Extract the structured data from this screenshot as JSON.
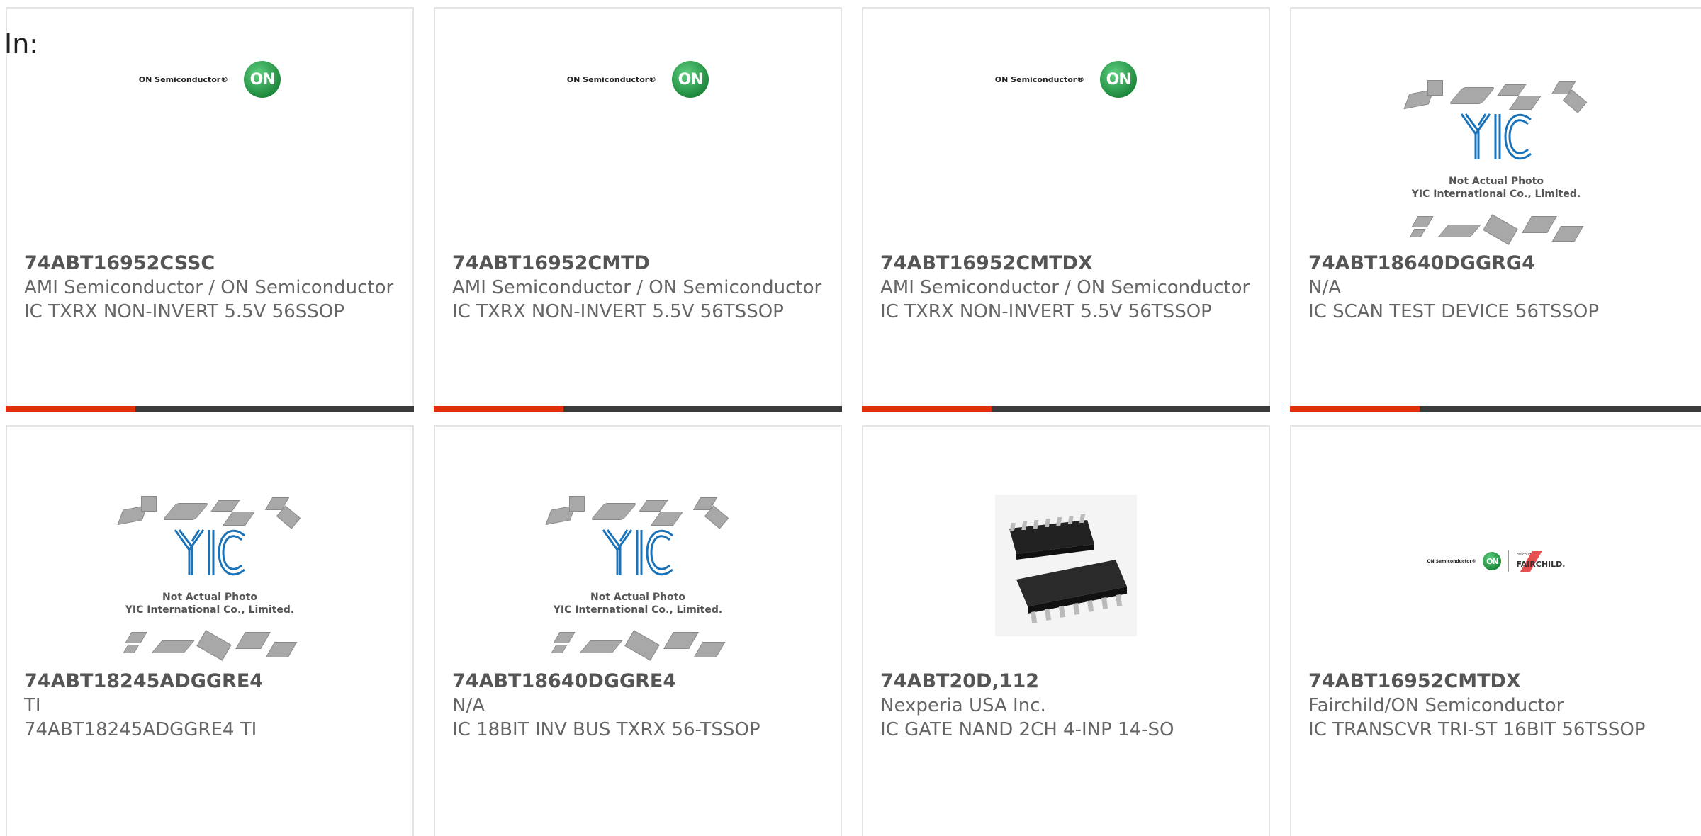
{
  "header": {
    "in_label": "In:"
  },
  "colors": {
    "accent": "#e0310c",
    "bar": "#3b3b3b",
    "on_green": "#1f8a3d",
    "yic_blue": "#1a72b8"
  },
  "products": [
    {
      "part": "74ABT16952CSSC",
      "manufacturer": "AMI Semiconductor / ON Semiconductor",
      "description": "IC TXRX NON-INVERT 5.5V 56SSOP",
      "image": "on-semiconductor-logo"
    },
    {
      "part": "74ABT16952CMTD",
      "manufacturer": "AMI Semiconductor / ON Semiconductor",
      "description": "IC TXRX NON-INVERT 5.5V 56TSSOP",
      "image": "on-semiconductor-logo"
    },
    {
      "part": "74ABT16952CMTDX",
      "manufacturer": "AMI Semiconductor / ON Semiconductor",
      "description": "IC TXRX NON-INVERT 5.5V 56TSSOP",
      "image": "on-semiconductor-logo"
    },
    {
      "part": "74ABT18640DGGRG4",
      "manufacturer": "N/A",
      "description": "IC SCAN TEST DEVICE 56TSSOP",
      "image": "yic-placeholder"
    },
    {
      "part": "74ABT18245ADGGRE4",
      "manufacturer": "TI",
      "description": "74ABT18245ADGGRE4 TI",
      "image": "yic-placeholder"
    },
    {
      "part": "74ABT18640DGGRE4",
      "manufacturer": "N/A",
      "description": "IC 18BIT INV BUS TXRX 56-TSSOP",
      "image": "yic-placeholder"
    },
    {
      "part": "74ABT20D,112",
      "manufacturer": "Nexperia USA Inc.",
      "description": "IC GATE NAND 2CH 4-INP 14-SO",
      "image": "soic-package-photo"
    },
    {
      "part": "74ABT16952CMTDX",
      "manufacturer": "Fairchild/ON Semiconductor",
      "description": "IC TRANSCVR TRI-ST 16BIT 56TSSOP",
      "image": "on-fairchild-logo"
    }
  ],
  "logos": {
    "on_text": "ON Semiconductor®",
    "on_mark": "ON",
    "fairchild_small": "Fairchild",
    "fairchild_text": "FAIRCHILD.",
    "yic_caption_line1": "Not Actual Photo",
    "yic_caption_line2": "YIC International Co., Limited."
  }
}
